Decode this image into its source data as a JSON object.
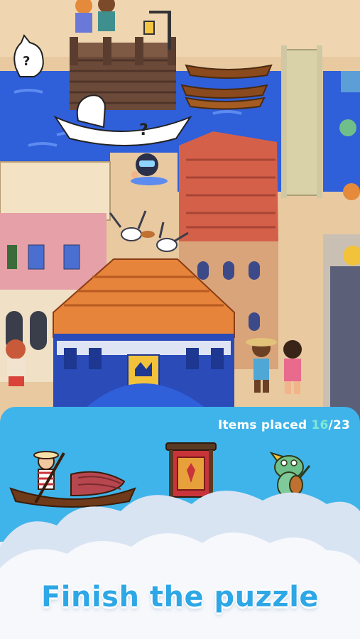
{
  "tray": {
    "label": "Items placed",
    "placed": "16",
    "separator": "/",
    "total": "23",
    "items": [
      {
        "name": "gondola-with-gondolier"
      },
      {
        "name": "banner-flag"
      },
      {
        "name": "frog-musician"
      }
    ]
  },
  "banner": {
    "headline": "Finish the puzzle"
  },
  "hints": [
    {
      "name": "cat-silhouette-hint",
      "symbol": "?"
    },
    {
      "name": "gondola-silhouette-hint",
      "symbol": "?"
    }
  ],
  "colors": {
    "water": "#2f5fd9",
    "tray": "#3fb4ea",
    "counter_accent": "#7fe9d6",
    "headline": "#2ea7e6"
  }
}
